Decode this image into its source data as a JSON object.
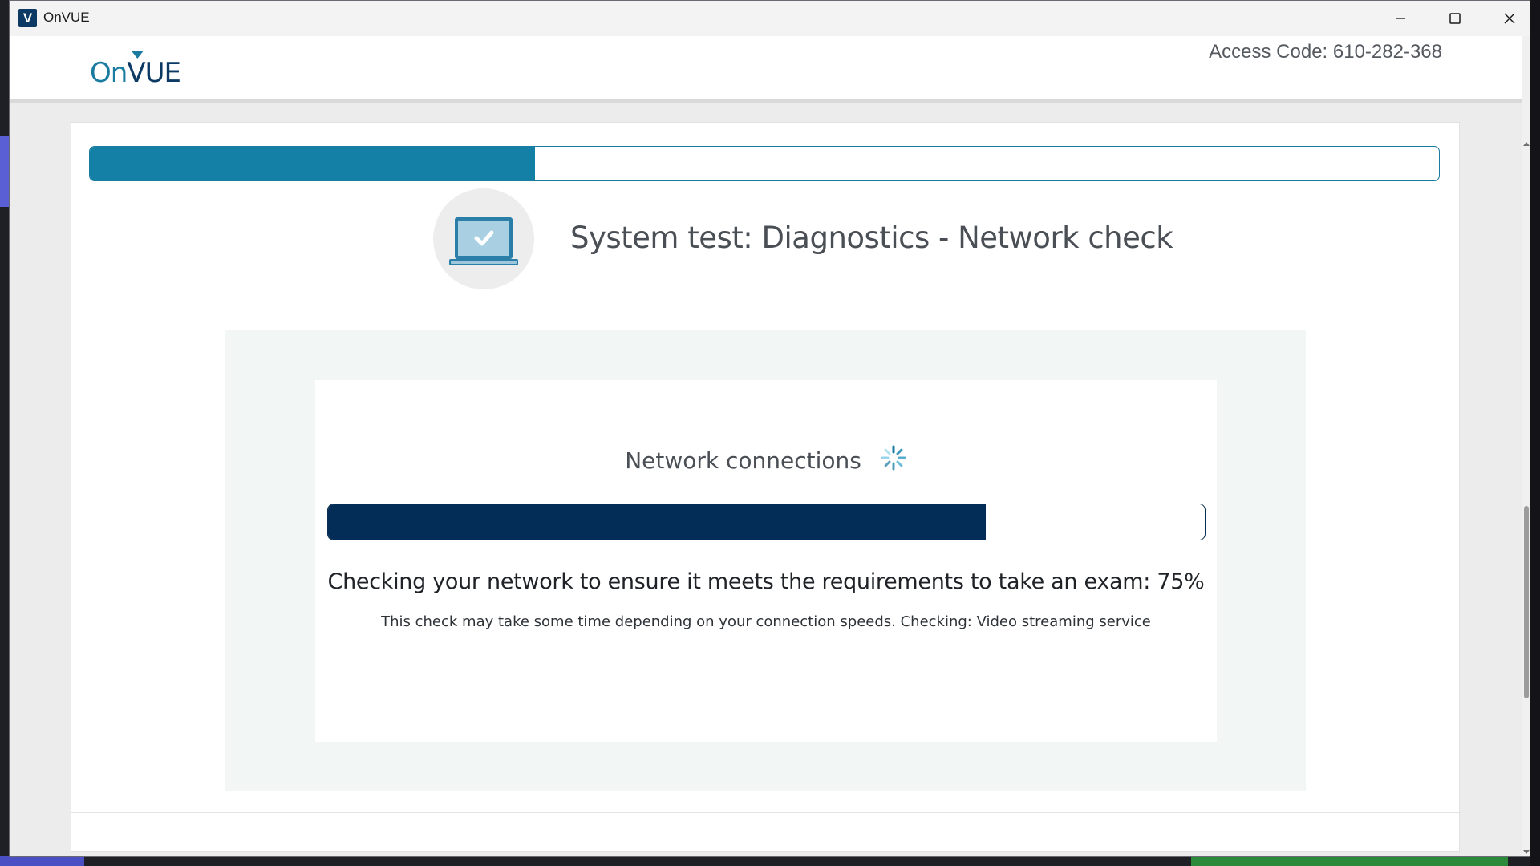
{
  "window": {
    "title": "OnVUE",
    "app_icon_letter": "V"
  },
  "header": {
    "logo": {
      "on": "On",
      "v": "V",
      "ue": "UE"
    },
    "access_code": "Access Code: 610-282-368"
  },
  "wizard": {
    "progress_fraction": 0.33,
    "step_title": "System test: Diagnostics - Network check",
    "step_icon": "laptop-check-icon"
  },
  "network_check": {
    "title": "Network connections",
    "spinner_icon": "loading-spinner-icon",
    "progress_percent": 75,
    "status_text": "Checking your network to ensure it meets the requirements to take an exam: 75%",
    "sub_text": "This check may take some time depending on your connection speeds. Checking: Video streaming service"
  },
  "colors": {
    "brand_dark": "#0c3a64",
    "brand_teal": "#1580a6",
    "progress_dark": "#032d57"
  }
}
